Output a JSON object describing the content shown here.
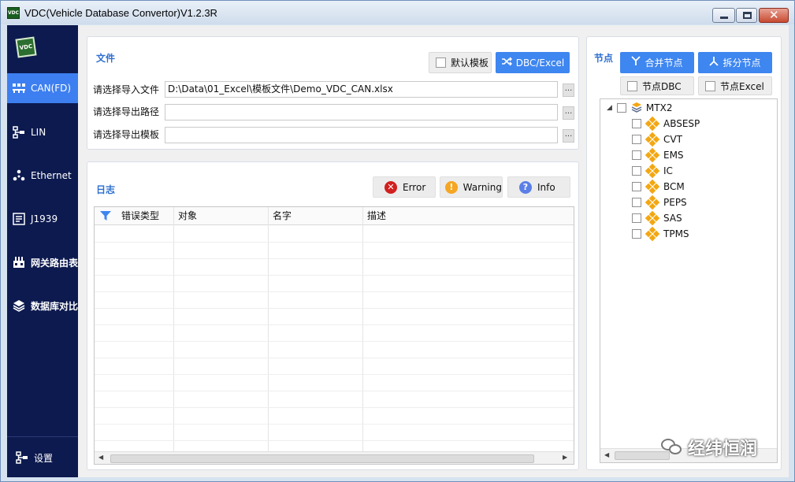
{
  "window": {
    "title": "VDC(Vehicle Database Convertor)V1.2.3R",
    "app_icon_text": "VDC"
  },
  "sidebar": {
    "logo_text": "VDC",
    "items": [
      {
        "label": "CAN(FD)",
        "icon": "network-icon",
        "active": true
      },
      {
        "label": "LIN",
        "icon": "lin-tree-icon",
        "active": false
      },
      {
        "label": "Ethernet",
        "icon": "ethernet-nodes-icon",
        "active": false
      },
      {
        "label": "J1939",
        "icon": "j1939-icon",
        "active": false
      },
      {
        "label": "网关路由表",
        "icon": "gateway-table-icon",
        "active": false
      },
      {
        "label": "数据库对比",
        "icon": "layers-icon",
        "active": false
      }
    ],
    "settings_label": "设置"
  },
  "file_panel": {
    "title": "文件",
    "default_template_label": "默认模板",
    "convert_button_label": "DBC/Excel",
    "rows": [
      {
        "label": "请选择导入文件",
        "value": "D:\\Data\\01_Excel\\模板文件\\Demo_VDC_CAN.xlsx"
      },
      {
        "label": "请选择导出路径",
        "value": ""
      },
      {
        "label": "请选择导出模板",
        "value": ""
      }
    ],
    "browse_label": "..."
  },
  "log_panel": {
    "title": "日志",
    "buttons": [
      {
        "label": "Error",
        "color": "#d21f1f",
        "glyph": "✕"
      },
      {
        "label": "Warning",
        "color": "#f5a623",
        "glyph": "!"
      },
      {
        "label": "Info",
        "color": "#5b7fe6",
        "glyph": "?"
      }
    ],
    "columns": [
      "错误类型",
      "对象",
      "名字",
      "描述"
    ],
    "rows": []
  },
  "node_panel": {
    "title": "节点",
    "merge_label": "合并节点",
    "split_label": "拆分节点",
    "node_dbc_label": "节点DBC",
    "node_excel_label": "节点Excel",
    "root": "MTX2",
    "nodes": [
      "ABSESP",
      "CVT",
      "EMS",
      "IC",
      "BCM",
      "PEPS",
      "SAS",
      "TPMS"
    ]
  },
  "watermark": {
    "text": "经纬恒润"
  },
  "colors": {
    "accent": "#3e86f0",
    "sidebar_bg": "#0d1a4f",
    "title_blue": "#2f6fd0",
    "node_icon": "#f3a712"
  }
}
